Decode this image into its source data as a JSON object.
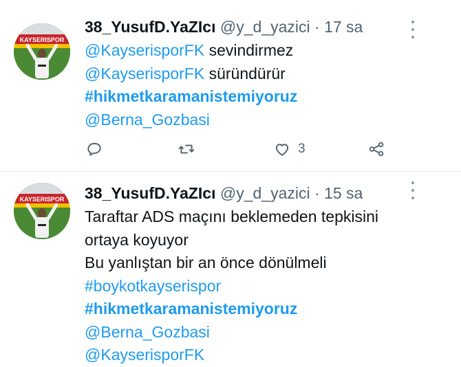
{
  "tweets": [
    {
      "display_name": "38_YusufD.YaZIcı",
      "handle": "@y_d_yazici",
      "separator": "·",
      "time": "17 sa",
      "lines": [
        {
          "text": "@KayserisporFK",
          "rest": " sevindirmez"
        },
        {
          "text": "@KayserisporFK",
          "rest": " süründürür"
        },
        {
          "text": "#hikmetkaramanistemiyoruz",
          "rest": ""
        },
        {
          "text": "@Berna_Gozbasi",
          "rest": ""
        }
      ],
      "actions": {
        "like_count": "3"
      },
      "avatar_banner_text": "KAYSERISPOR"
    },
    {
      "display_name": "38_YusufD.YaZIcı",
      "handle": "@y_d_yazici",
      "separator": "·",
      "time": "15 sa",
      "lines": [
        {
          "text": "Taraftar ADS maçını beklemeden tepkisini"
        },
        {
          "text": "ortaya koyuyor"
        },
        {
          "text": "Bu yanlıştan bir an önce dönülmeli"
        },
        {
          "text": "#boykotkayserispor"
        },
        {
          "text": "#hikmetkaramanistemiyoruz"
        },
        {
          "text": "@Berna_Gozbasi"
        },
        {
          "text": "@KayserisporFK"
        }
      ],
      "avatar_banner_text": "KAYSERISPOR"
    }
  ],
  "icons": {
    "reply": "reply-icon",
    "retweet": "retweet-icon",
    "like": "heart-icon",
    "share": "share-icon",
    "more": "more-options-icon"
  },
  "colors": {
    "link": "#1d9bf0",
    "muted": "#536471",
    "text": "#0f1419"
  }
}
